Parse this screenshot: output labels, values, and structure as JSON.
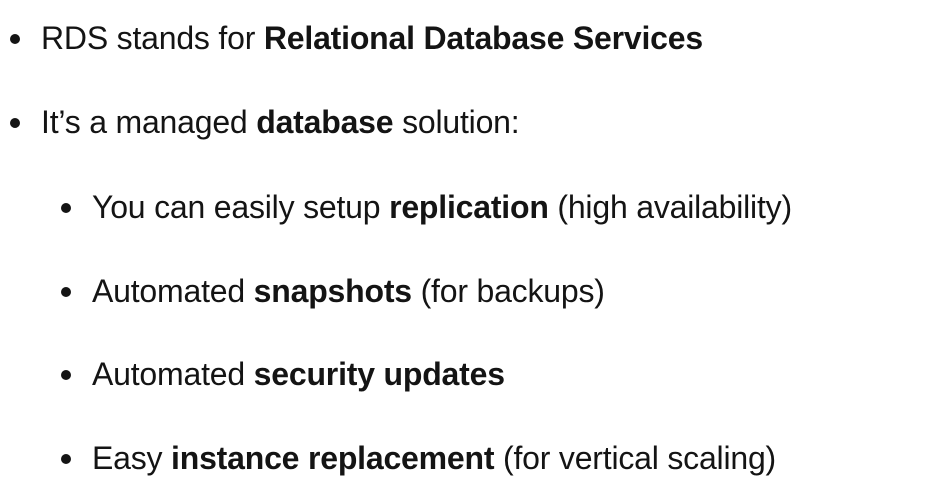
{
  "bullets": [
    {
      "level": 1,
      "parts": [
        "RDS stands for ",
        "Relational Database Services"
      ]
    },
    {
      "level": 1,
      "parts": [
        "It’s a managed ",
        "database",
        " solution:"
      ]
    },
    {
      "level": 2,
      "parts": [
        "You can easily setup ",
        "replication",
        " (high availability)"
      ]
    },
    {
      "level": 2,
      "parts": [
        "Automated ",
        "snapshots",
        " (for backups)"
      ]
    },
    {
      "level": 2,
      "parts": [
        "Automated ",
        "security updates"
      ]
    },
    {
      "level": 2,
      "parts": [
        "Easy ",
        "instance replacement",
        " (for vertical scaling)"
      ]
    }
  ],
  "colors": {
    "text": "#141414",
    "background": "#ffffff"
  }
}
